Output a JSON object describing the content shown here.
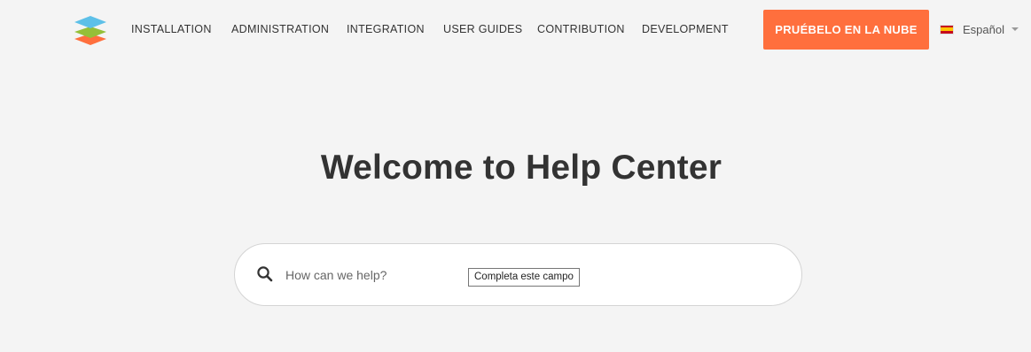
{
  "nav": {
    "items": [
      {
        "label": "INSTALLATION"
      },
      {
        "label": "ADMINISTRATION"
      },
      {
        "label": "INTEGRATION"
      },
      {
        "label": "USER GUIDES"
      },
      {
        "label": "CONTRIBUTION"
      },
      {
        "label": "DEVELOPMENT"
      }
    ]
  },
  "cta": {
    "label": "PRUÉBELO EN LA NUBE",
    "color": "#ff6f3d"
  },
  "language": {
    "label": "Español",
    "flag_icon": "spain-flag-icon"
  },
  "hero": {
    "title": "Welcome to Help Center"
  },
  "search": {
    "placeholder": "How can we help?",
    "value": "",
    "validation_tooltip": "Completa este campo"
  },
  "logo": {
    "icon": "stacked-layers-logo",
    "colors": [
      "#5dc0e8",
      "#95c038",
      "#ff6f3d"
    ]
  }
}
